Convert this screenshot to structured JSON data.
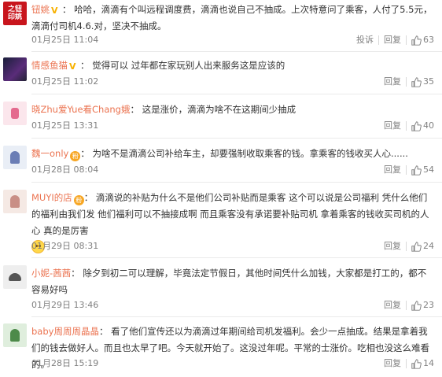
{
  "labels": {
    "report": "投诉",
    "reply": "回复"
  },
  "comments": [
    {
      "user": "钮姚",
      "badge": "V",
      "colon": "：",
      "text": "哈哈，滴滴有个叫远程调度费，滴滴也说自己不抽成。上次特意问了乘客，人付了5.5元，滴滴付司机4.6.对，坚决不抽成。",
      "time": "01月25日 11:04",
      "likes": "63",
      "avatar_text": "之钮印姚"
    },
    {
      "user": "情感鱼猫",
      "badge": "V",
      "colon": "：",
      "text": "觉得可以 过年都在家玩别人出来服务这是应该的",
      "time": "01月25日 11:02",
      "likes": "35"
    },
    {
      "user": "晓Zhu爱Yue看Chang娥",
      "colon": "：",
      "text": "这是涨价，滴滴为啥不在这期间少抽成",
      "time": "01月25日 13:31",
      "likes": "40"
    },
    {
      "user": "魏一only",
      "fan_badge": "粉",
      "colon": "：",
      "text": "为啥不是滴滴公司补给车主，却要强制收取乘客的钱。拿乘客的钱收买人心......",
      "time": "01月28日 08:04",
      "likes": "54"
    },
    {
      "user": "MUYI的店",
      "fan_badge": "粉",
      "colon": "：",
      "text": "滴滴说的补贴为什么不是他们公司补贴而是乘客 这个可以说是公司福利 凭什么他们的福利由我们发 他们福利可以不抽接成啊 而且乘客没有承诺要补贴司机 拿着乘客的钱收买司机的人心 真的是厉害",
      "time": "01月29日 08:31",
      "likes": "24"
    },
    {
      "user": "小妮-茜茜",
      "colon": "：",
      "text": "除夕到初二可以理解，毕竟法定节假日，其他时间凭什么加钱，大家都是打工的，都不容易好吗",
      "time": "01月29日 13:46",
      "likes": "23"
    },
    {
      "user": "baby周周周晶晶",
      "colon": "：",
      "text": "看了他们宣传还以为滴滴过年期间给司机发福利。会少一点抽成。结果是拿着我们的钱去做好人。而且也太早了吧。今天就开始了。这没过年呢。平常的士涨价。吃相也没这么难看的。",
      "time": "01月28日 15:19",
      "likes": "14"
    }
  ]
}
